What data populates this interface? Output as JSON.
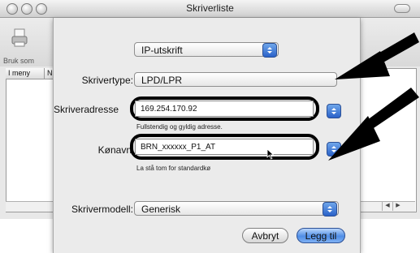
{
  "window": {
    "title": "Skriverliste",
    "toolbar_label": "Bruk som",
    "list_columns": [
      "I meny",
      "N"
    ]
  },
  "sheet": {
    "protocol_popup": "IP-utskrift",
    "printer_type_label": "Skrivertype:",
    "printer_type_value": "LPD/LPR",
    "address_label": "Skriveradresse",
    "address_value": "169.254.170.92",
    "address_hint": "Fullstendig og gyldig adresse.",
    "name_label": "Kønavn",
    "name_value": "BRN_xxxxxx_P1_AT",
    "name_hint": "La stå tom for standardkø",
    "model_label": "Skrivermodell:",
    "model_value": "Generisk",
    "cancel_button": "Avbryt",
    "add_button": "Legg til"
  },
  "colors": {
    "accent_blue": "#2a62c9",
    "highlight_border": "#000000",
    "arrow": "#000000"
  },
  "icons": [
    "window-close-icon",
    "window-minimize-icon",
    "window-zoom-icon",
    "toolbar-printer-icon",
    "popup-stepper-icon",
    "scroll-left-icon",
    "scroll-right-icon",
    "pointer-arrow-icon",
    "annotation-arrow-icon"
  ]
}
